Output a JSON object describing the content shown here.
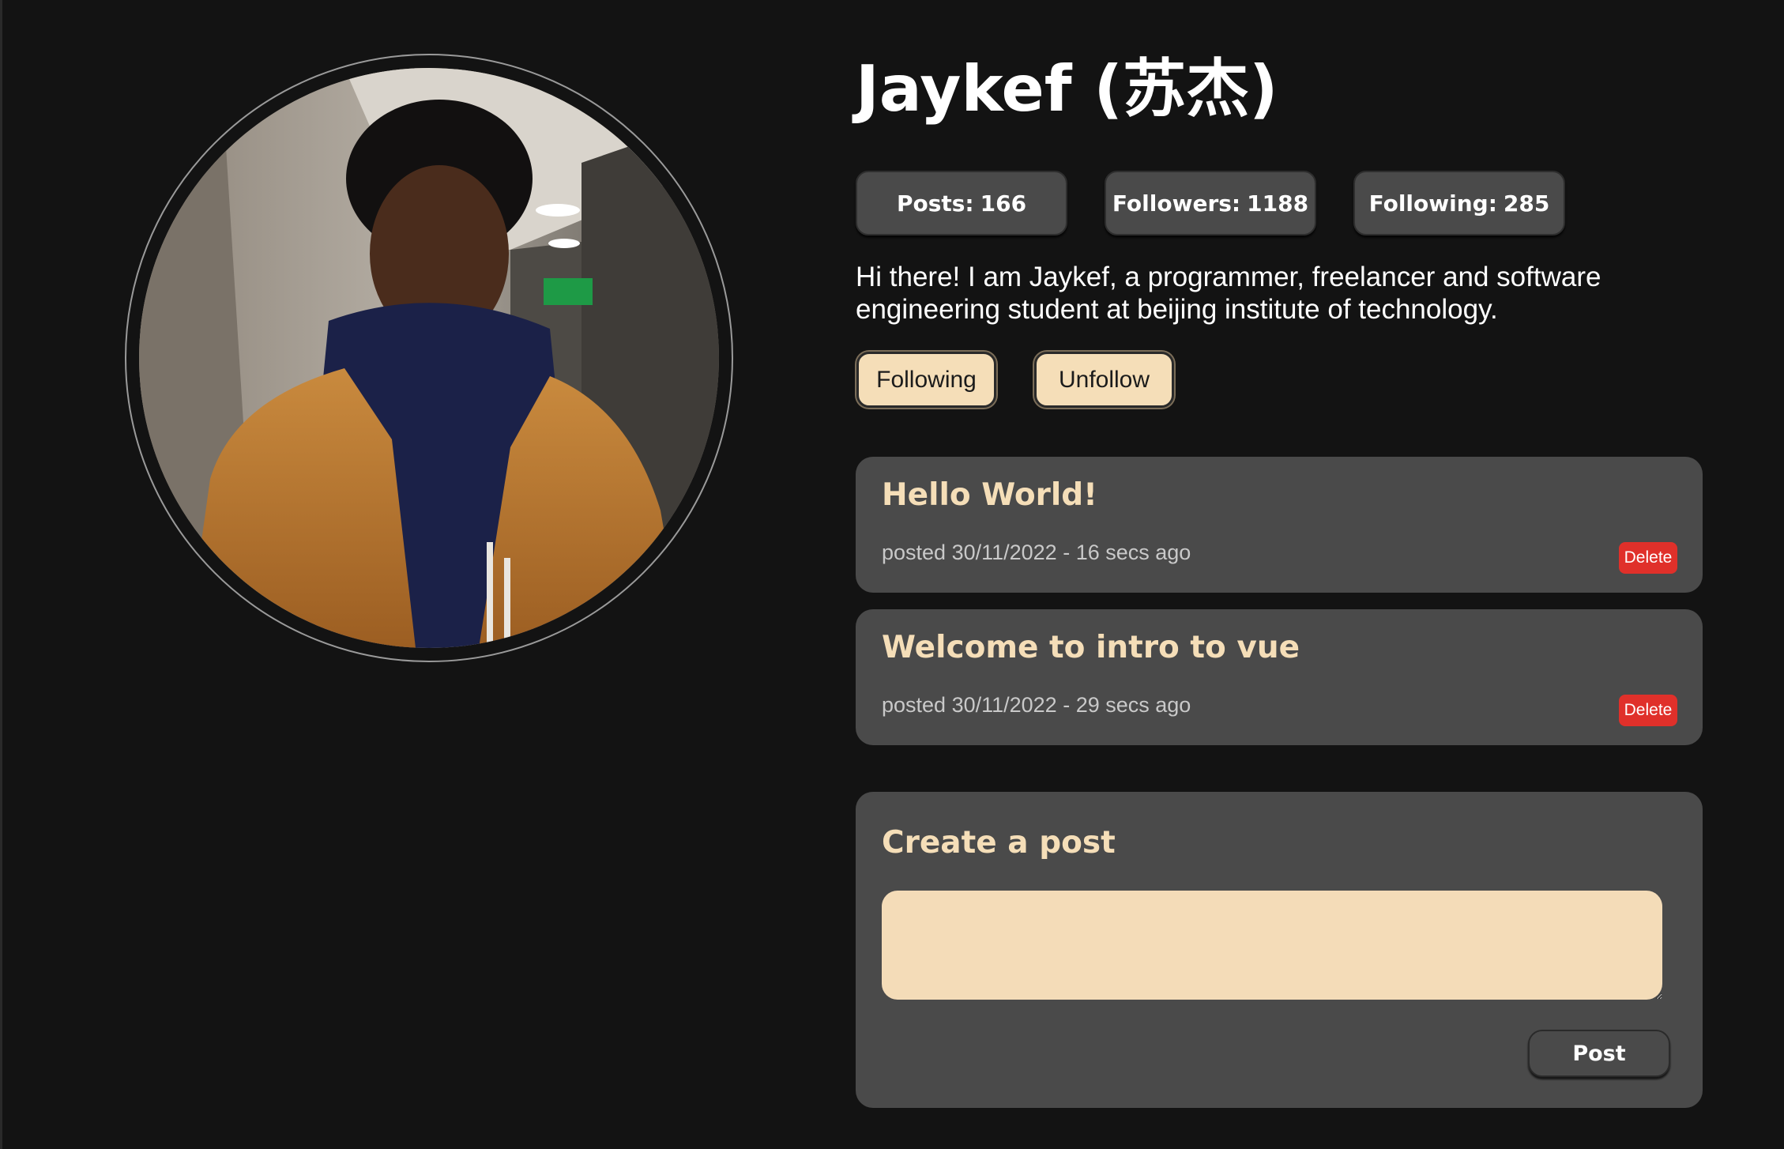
{
  "profile": {
    "name": "Jaykef (苏杰)",
    "avatar_icon": "profile-photo",
    "bio": "Hi there! I am Jaykef, a programmer, freelancer and software engineering student at beijing institute of technology."
  },
  "stats": {
    "posts_label": "Posts:",
    "posts_value": "166",
    "followers_label": "Followers:",
    "followers_value": "1188",
    "following_label": "Following:",
    "following_value": "285"
  },
  "actions": {
    "following_label": "Following",
    "unfollow_label": "Unfollow"
  },
  "posts": [
    {
      "title": "Hello World!",
      "meta": "posted 30/11/2022 - 16 secs ago",
      "delete_label": "Delete"
    },
    {
      "title": "Welcome to intro to vue",
      "meta": "posted 30/11/2022 - 29 secs ago",
      "delete_label": "Delete"
    }
  ],
  "create_post": {
    "title": "Create a post",
    "input_value": "",
    "submit_label": "Post"
  },
  "colors": {
    "background": "#131313",
    "card": "#4a4a4a",
    "accent": "#f5deb8",
    "danger": "#e0302a"
  }
}
